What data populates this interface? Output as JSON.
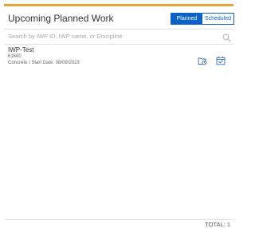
{
  "header": {
    "title": "Upcoming Planned Work",
    "toggle": {
      "planned_label": "Planned",
      "scheduled_label": "Scheduled",
      "selected": "Planned"
    }
  },
  "search": {
    "placeholder": "Search by IWP ID, IWP name, or Discipline",
    "value": "",
    "icon": "search-icon"
  },
  "items": [
    {
      "title": "IWP-Test",
      "id": "61600",
      "meta": "Concrete / Start Date: 08/09/2023",
      "actions": [
        {
          "icon": "folder-clock-icon"
        },
        {
          "icon": "calendar-check-icon"
        }
      ]
    }
  ],
  "footer": {
    "total_text": "TOTAL: 1"
  },
  "colors": {
    "accent": "#e8a43a",
    "primary": "#0a62c7",
    "icon": "#2f6fb8"
  }
}
